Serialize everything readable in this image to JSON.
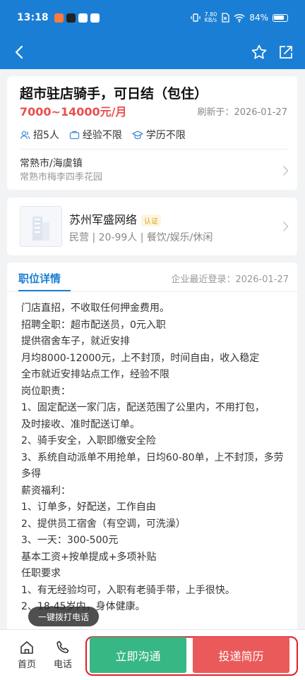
{
  "status_bar": {
    "time": "13:18",
    "speed_value": "7.80",
    "speed_unit": "KB/s",
    "battery": "84%"
  },
  "job": {
    "title": "超市驻店骑手，可日结（包住）",
    "salary": "7000~14000元/月",
    "refresh": "刷新于：2026-01-27",
    "tags": [
      "招5人",
      "经验不限",
      "学历不限"
    ],
    "location_city": "常熟市/海虞镇",
    "location_address": "常熟市梅李四季花园"
  },
  "company": {
    "name": "苏州军盛网络",
    "badge": "认证",
    "meta": "民营 | 20-99人 | 餐饮/娱乐/休闲"
  },
  "detail": {
    "tab_label": "职位详情",
    "last_login": "企业最近登录：2026-01-27",
    "description": "门店直招，不收取任何押金费用。\n招聘全职：超市配送员，0元入职\n提供宿舍车子，就近安排\n月均8000-12000元，上不封顶，时间自由，收入稳定\n全市就近安排站点工作，经验不限\n岗位职责：\n1、固定配送一家门店，配送范围了公里内，不用打包，\n及时接收、准时配送订单。\n2、骑手安全，入职即缴安全险\n3、系统自动派单不用抢单，日均60-80单，上不封顶，多劳多得\n薪资福利：\n1、订单多，好配送，工作自由\n2、提供员工宿舍（有空调，可洗澡）\n3、一天：300-500元\n基本工资+按单提成+多项补贴\n任职要求\n1、有无经验均可，入职有老骑手带，上手很快。\n2、18-45岁内，身体健康。"
  },
  "float_call_label": "一键拨打电话",
  "bottom_bar": {
    "home_label": "首页",
    "phone_label": "电话",
    "chat_label": "立即沟通",
    "apply_label": "投递简历"
  },
  "colors": {
    "primary": "#1a7fd4",
    "salary": "#e94f4f",
    "chat_button": "#37b783",
    "apply_button": "#eb5a5a",
    "highlight_outline": "#e0202a"
  }
}
